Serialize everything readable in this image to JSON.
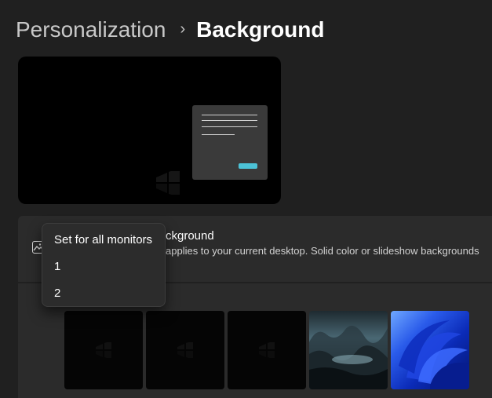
{
  "breadcrumb": {
    "parent": "Personalization",
    "separator": "›",
    "current": "Background"
  },
  "preview": {
    "window_lines": 4,
    "accent": "#4cc2d6"
  },
  "background_card": {
    "icon": "image-icon",
    "title": "ckground",
    "description": "applies to your current desktop. Solid color or slideshow backgrounds"
  },
  "recent_images": [
    {
      "name": "windows-dark-1"
    },
    {
      "name": "windows-dark-2"
    },
    {
      "name": "windows-dark-3"
    },
    {
      "name": "dark-landscape"
    },
    {
      "name": "windows-11-bloom"
    }
  ],
  "context_menu": {
    "items": [
      {
        "label": "Set for all monitors"
      },
      {
        "label": "1"
      },
      {
        "label": "2"
      }
    ]
  }
}
